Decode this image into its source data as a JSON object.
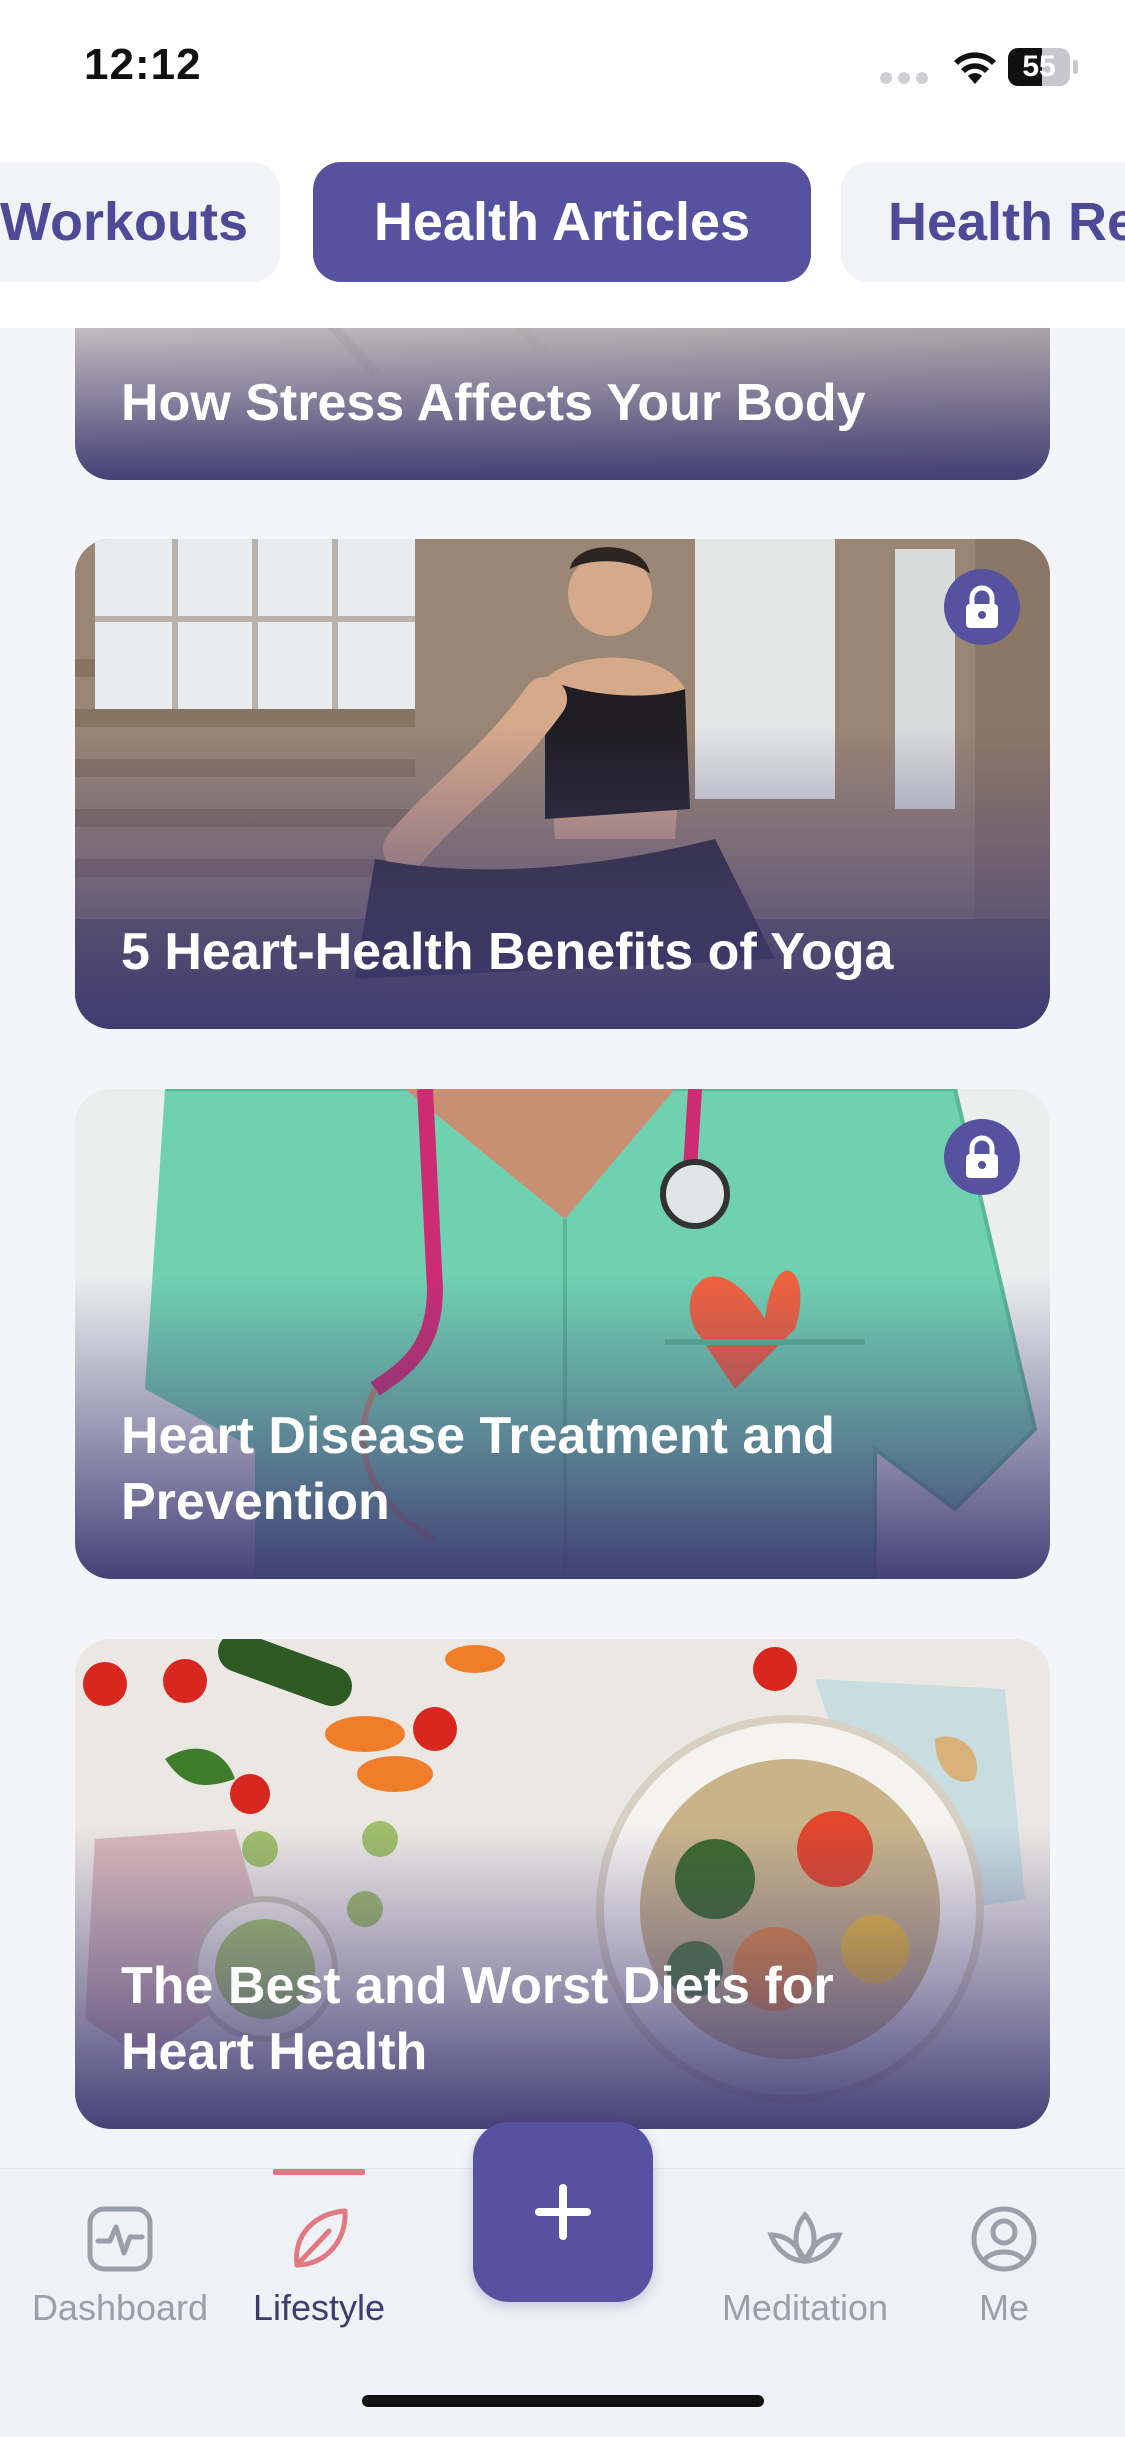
{
  "status_bar": {
    "time": "12:12",
    "battery": "55"
  },
  "tabs": [
    {
      "label": "Workouts"
    },
    {
      "label": "Health Articles",
      "active": true
    },
    {
      "label": "Health Records"
    }
  ],
  "articles": [
    {
      "title": "How Stress Affects Your Body",
      "locked": false
    },
    {
      "title": "5 Heart-Health Benefits of Yoga",
      "locked": true
    },
    {
      "title": "Heart Disease Treatment and Prevention",
      "locked": true
    },
    {
      "title": "The Best and Worst Diets for Heart Health",
      "locked": false
    }
  ],
  "bottom_nav": {
    "items": [
      {
        "label": "Dashboard",
        "icon": "dashboard-icon"
      },
      {
        "label": "Lifestyle",
        "icon": "leaf-icon",
        "active": true
      },
      {
        "label": "Meditation",
        "icon": "lotus-icon"
      },
      {
        "label": "Me",
        "icon": "user-icon"
      }
    ],
    "add_icon": "plus-icon"
  },
  "colors": {
    "accent": "#5652a0",
    "active_indicator": "#e07a80",
    "inactive": "#9aa0aa"
  }
}
